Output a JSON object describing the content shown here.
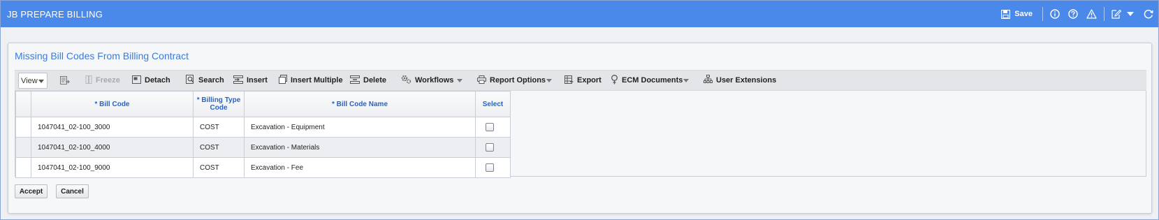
{
  "app": {
    "title": "JB PREPARE BILLING",
    "save_label": "Save",
    "brand_color": "#4a89ea",
    "header_icons": [
      "save-icon",
      "info-icon",
      "help-icon",
      "warning-icon",
      "edit-icon",
      "chevron-down-icon",
      "refresh-icon"
    ]
  },
  "panel": {
    "title": "Missing Bill Codes From Billing Contract"
  },
  "toolbar": {
    "view_label": "View",
    "freeze_label": "Freeze",
    "detach_label": "Detach",
    "search_label": "Search",
    "insert_label": "Insert",
    "insert_multiple_label": "Insert Multiple",
    "delete_label": "Delete",
    "workflows_label": "Workflows",
    "report_options_label": "Report Options",
    "export_label": "Export",
    "ecm_documents_label": "ECM Documents",
    "user_extensions_label": "User Extensions"
  },
  "grid": {
    "columns": [
      "* Bill Code",
      "* Billing Type Code",
      "* Bill Code Name",
      "Select"
    ],
    "column_billing_type_line1": "* Billing Type",
    "column_billing_type_line2": "Code",
    "rows": [
      {
        "bill_code": "1047041_02-100_3000",
        "billing_type": "COST",
        "name": "Excavation - Equipment",
        "selected": false
      },
      {
        "bill_code": "1047041_02-100_4000",
        "billing_type": "COST",
        "name": "Excavation - Materials",
        "selected": false
      },
      {
        "bill_code": "1047041_02-100_9000",
        "billing_type": "COST",
        "name": "Excavation - Fee",
        "selected": false
      }
    ]
  },
  "actions": {
    "accept_label": "Accept",
    "cancel_label": "Cancel"
  }
}
